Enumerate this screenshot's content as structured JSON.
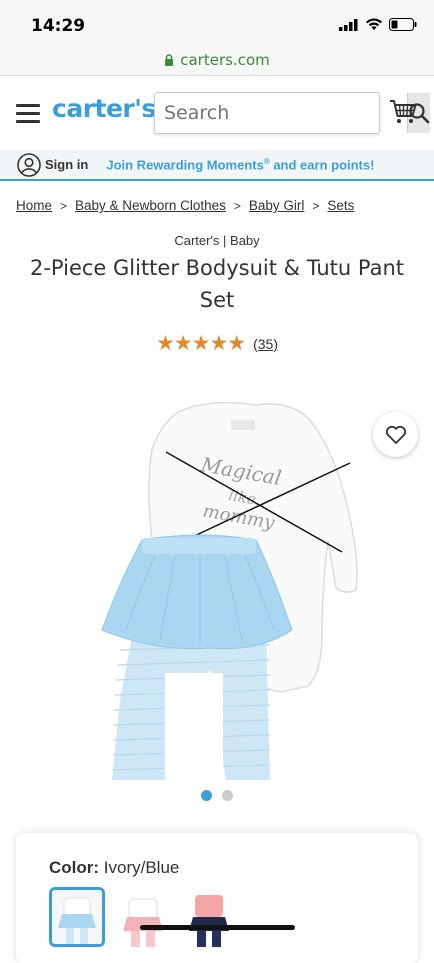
{
  "status": {
    "time": "14:29"
  },
  "browser": {
    "url": "carters.com"
  },
  "header": {
    "logo": "carter's",
    "search_placeholder": "Search"
  },
  "account_bar": {
    "signin": "Sign in",
    "rewards_prefix": "Join Rewarding Moments",
    "rewards_mark": "®",
    "rewards_suffix": " and earn points!"
  },
  "breadcrumb": [
    {
      "label": "Home"
    },
    {
      "label": "Baby & Newborn Clothes"
    },
    {
      "label": "Baby Girl"
    },
    {
      "label": "Sets"
    }
  ],
  "breadcrumb_separator": ">",
  "product": {
    "brand": "Carter's | Baby",
    "title": "2-Piece Glitter Bodysuit & Tutu Pant Set",
    "stars": "★★★★★",
    "rating_value": 5,
    "review_count": "(35)",
    "print_text": [
      "Magical",
      "like",
      "mommy"
    ],
    "image_total": 2,
    "image_current": 1
  },
  "color_selector": {
    "label": "Color:",
    "value": "Ivory/Blue",
    "swatches": [
      {
        "name": "Ivory/Blue",
        "selected": true
      },
      {
        "name": "Ivory/Pink",
        "selected": false
      },
      {
        "name": "Navy/Pink",
        "selected": false
      }
    ]
  },
  "colors": {
    "brand_blue": "#3a9fd8",
    "star_orange": "#e08a2e",
    "secure_green": "#3a8a3a"
  }
}
